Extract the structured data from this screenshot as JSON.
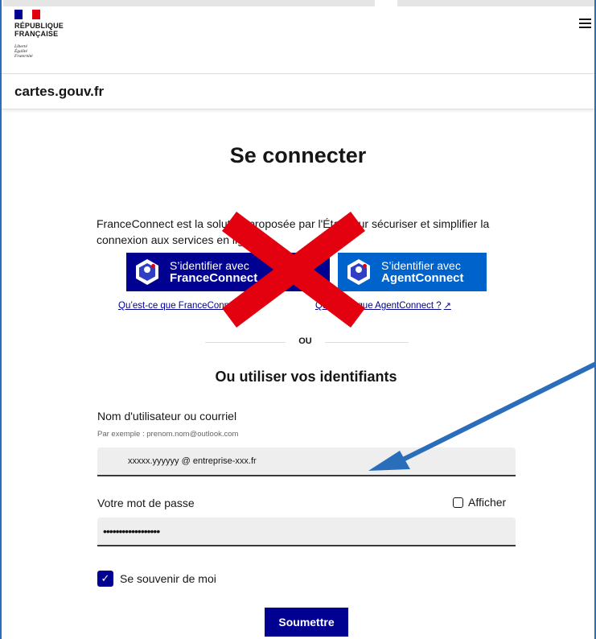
{
  "header": {
    "gov_name_line1": "RÉPUBLIQUE",
    "gov_name_line2": "FRANÇAISE",
    "motto_1": "Liberté",
    "motto_2": "Égalité",
    "motto_3": "Fraternité",
    "menu_icon": "hamburger-menu-icon"
  },
  "site": {
    "title": "cartes.gouv.fr"
  },
  "login": {
    "title": "Se connecter",
    "intro": "FranceConnect est la solution proposée par l'État pour sécuriser et simplifier la connexion aux services en ligne.",
    "franceconnect_button": {
      "line1": "S’identifier avec",
      "line2": "FranceConnect"
    },
    "agentconnect_button": {
      "line1": "S’identifier avec",
      "line2": "AgentConnect"
    },
    "franceconnect_link": "Qu’est-ce que FranceConnect ?",
    "agentconnect_link": "Qu’est-ce que AgentConnect ?",
    "separator": "OU",
    "alt_title": "Ou utiliser vos identifiants",
    "username_label": "Nom d'utilisateur ou courriel",
    "username_hint": "Par exemple : prenom.nom@outlook.com",
    "username_value": "xxxxx.yyyyyy @ entreprise-xxx.fr",
    "password_label": "Votre mot de passe",
    "password_value": "••••••••••••••••••",
    "show_password_label": "Afficher",
    "show_password_checked": false,
    "remember_label": "Se souvenir de moi",
    "remember_checked": true,
    "submit_label": "Soumettre"
  },
  "annotations": {
    "cross_color": "#e3000f",
    "arrow_color": "#2a6ebb"
  },
  "colors": {
    "primary": "#000091",
    "agentconnect": "#0063cb",
    "marianne_red": "#e1000f"
  }
}
